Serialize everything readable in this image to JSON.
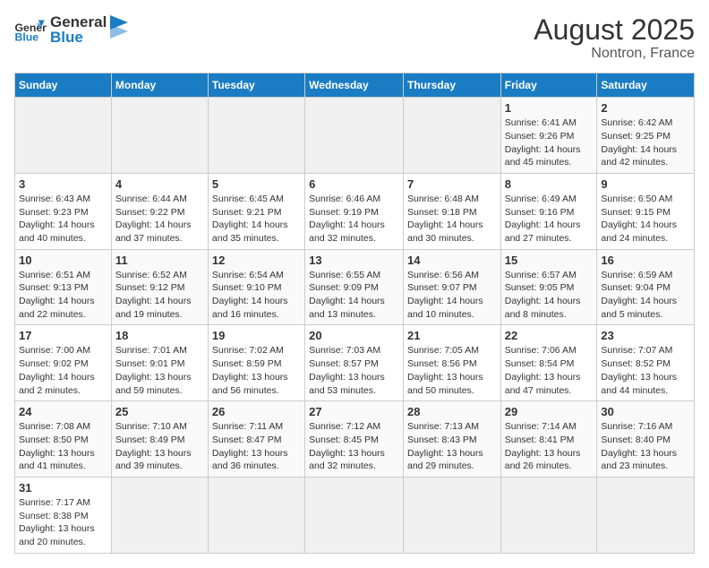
{
  "header": {
    "logo_general": "General",
    "logo_blue": "Blue",
    "title": "August 2025",
    "subtitle": "Nontron, France"
  },
  "weekdays": [
    "Sunday",
    "Monday",
    "Tuesday",
    "Wednesday",
    "Thursday",
    "Friday",
    "Saturday"
  ],
  "weeks": [
    [
      {
        "day": "",
        "info": ""
      },
      {
        "day": "",
        "info": ""
      },
      {
        "day": "",
        "info": ""
      },
      {
        "day": "",
        "info": ""
      },
      {
        "day": "",
        "info": ""
      },
      {
        "day": "1",
        "info": "Sunrise: 6:41 AM\nSunset: 9:26 PM\nDaylight: 14 hours\nand 45 minutes."
      },
      {
        "day": "2",
        "info": "Sunrise: 6:42 AM\nSunset: 9:25 PM\nDaylight: 14 hours\nand 42 minutes."
      }
    ],
    [
      {
        "day": "3",
        "info": "Sunrise: 6:43 AM\nSunset: 9:23 PM\nDaylight: 14 hours\nand 40 minutes."
      },
      {
        "day": "4",
        "info": "Sunrise: 6:44 AM\nSunset: 9:22 PM\nDaylight: 14 hours\nand 37 minutes."
      },
      {
        "day": "5",
        "info": "Sunrise: 6:45 AM\nSunset: 9:21 PM\nDaylight: 14 hours\nand 35 minutes."
      },
      {
        "day": "6",
        "info": "Sunrise: 6:46 AM\nSunset: 9:19 PM\nDaylight: 14 hours\nand 32 minutes."
      },
      {
        "day": "7",
        "info": "Sunrise: 6:48 AM\nSunset: 9:18 PM\nDaylight: 14 hours\nand 30 minutes."
      },
      {
        "day": "8",
        "info": "Sunrise: 6:49 AM\nSunset: 9:16 PM\nDaylight: 14 hours\nand 27 minutes."
      },
      {
        "day": "9",
        "info": "Sunrise: 6:50 AM\nSunset: 9:15 PM\nDaylight: 14 hours\nand 24 minutes."
      }
    ],
    [
      {
        "day": "10",
        "info": "Sunrise: 6:51 AM\nSunset: 9:13 PM\nDaylight: 14 hours\nand 22 minutes."
      },
      {
        "day": "11",
        "info": "Sunrise: 6:52 AM\nSunset: 9:12 PM\nDaylight: 14 hours\nand 19 minutes."
      },
      {
        "day": "12",
        "info": "Sunrise: 6:54 AM\nSunset: 9:10 PM\nDaylight: 14 hours\nand 16 minutes."
      },
      {
        "day": "13",
        "info": "Sunrise: 6:55 AM\nSunset: 9:09 PM\nDaylight: 14 hours\nand 13 minutes."
      },
      {
        "day": "14",
        "info": "Sunrise: 6:56 AM\nSunset: 9:07 PM\nDaylight: 14 hours\nand 10 minutes."
      },
      {
        "day": "15",
        "info": "Sunrise: 6:57 AM\nSunset: 9:05 PM\nDaylight: 14 hours\nand 8 minutes."
      },
      {
        "day": "16",
        "info": "Sunrise: 6:59 AM\nSunset: 9:04 PM\nDaylight: 14 hours\nand 5 minutes."
      }
    ],
    [
      {
        "day": "17",
        "info": "Sunrise: 7:00 AM\nSunset: 9:02 PM\nDaylight: 14 hours\nand 2 minutes."
      },
      {
        "day": "18",
        "info": "Sunrise: 7:01 AM\nSunset: 9:01 PM\nDaylight: 13 hours\nand 59 minutes."
      },
      {
        "day": "19",
        "info": "Sunrise: 7:02 AM\nSunset: 8:59 PM\nDaylight: 13 hours\nand 56 minutes."
      },
      {
        "day": "20",
        "info": "Sunrise: 7:03 AM\nSunset: 8:57 PM\nDaylight: 13 hours\nand 53 minutes."
      },
      {
        "day": "21",
        "info": "Sunrise: 7:05 AM\nSunset: 8:56 PM\nDaylight: 13 hours\nand 50 minutes."
      },
      {
        "day": "22",
        "info": "Sunrise: 7:06 AM\nSunset: 8:54 PM\nDaylight: 13 hours\nand 47 minutes."
      },
      {
        "day": "23",
        "info": "Sunrise: 7:07 AM\nSunset: 8:52 PM\nDaylight: 13 hours\nand 44 minutes."
      }
    ],
    [
      {
        "day": "24",
        "info": "Sunrise: 7:08 AM\nSunset: 8:50 PM\nDaylight: 13 hours\nand 41 minutes."
      },
      {
        "day": "25",
        "info": "Sunrise: 7:10 AM\nSunset: 8:49 PM\nDaylight: 13 hours\nand 39 minutes."
      },
      {
        "day": "26",
        "info": "Sunrise: 7:11 AM\nSunset: 8:47 PM\nDaylight: 13 hours\nand 36 minutes."
      },
      {
        "day": "27",
        "info": "Sunrise: 7:12 AM\nSunset: 8:45 PM\nDaylight: 13 hours\nand 32 minutes."
      },
      {
        "day": "28",
        "info": "Sunrise: 7:13 AM\nSunset: 8:43 PM\nDaylight: 13 hours\nand 29 minutes."
      },
      {
        "day": "29",
        "info": "Sunrise: 7:14 AM\nSunset: 8:41 PM\nDaylight: 13 hours\nand 26 minutes."
      },
      {
        "day": "30",
        "info": "Sunrise: 7:16 AM\nSunset: 8:40 PM\nDaylight: 13 hours\nand 23 minutes."
      }
    ],
    [
      {
        "day": "31",
        "info": "Sunrise: 7:17 AM\nSunset: 8:38 PM\nDaylight: 13 hours\nand 20 minutes."
      },
      {
        "day": "",
        "info": ""
      },
      {
        "day": "",
        "info": ""
      },
      {
        "day": "",
        "info": ""
      },
      {
        "day": "",
        "info": ""
      },
      {
        "day": "",
        "info": ""
      },
      {
        "day": "",
        "info": ""
      }
    ]
  ]
}
